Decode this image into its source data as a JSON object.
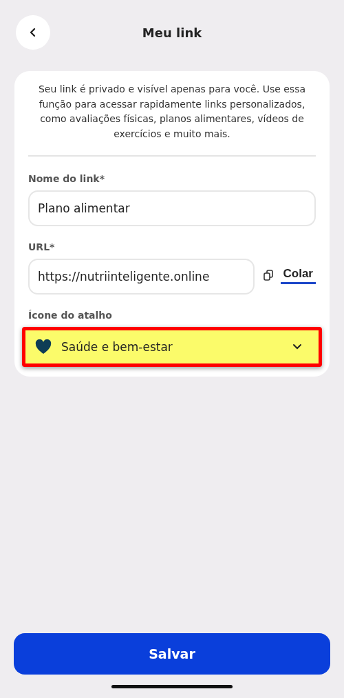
{
  "header": {
    "title": "Meu link"
  },
  "card": {
    "description": "Seu link é privado e visível apenas para você. Use essa função para acessar rapidamente links personalizados, como avaliações físicas, planos alimentares, vídeos de exercícios e muito mais.",
    "fields": [
      {
        "label": "Nome do link*",
        "value": "Plano alimentar"
      },
      {
        "label": "URL*",
        "value": "https://nutriinteligente.online",
        "action": "Colar"
      }
    ],
    "shortcut": {
      "label": "Ícone do atalho",
      "value": "Saúde e bem-estar",
      "highlighted": true
    }
  },
  "save_button": "Salvar"
}
